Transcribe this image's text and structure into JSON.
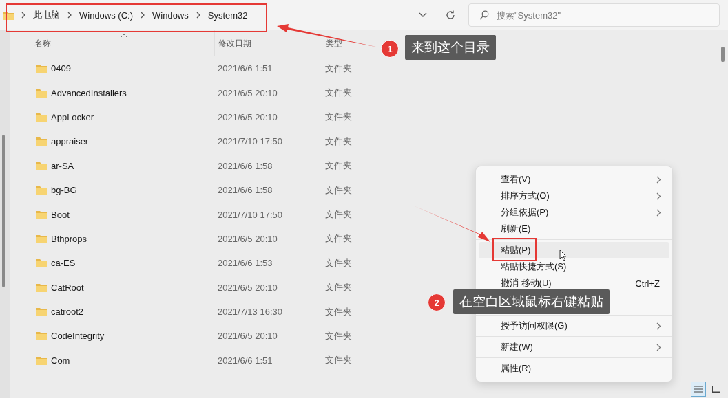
{
  "breadcrumb": [
    {
      "label": "此电脑"
    },
    {
      "label": "Windows (C:)"
    },
    {
      "label": "Windows"
    },
    {
      "label": "System32"
    }
  ],
  "search": {
    "placeholder": "搜索\"System32\""
  },
  "columns": [
    {
      "label": "名称",
      "sorted": true
    },
    {
      "label": "修改日期",
      "sorted": false
    },
    {
      "label": "类型",
      "sorted": false
    }
  ],
  "rows": [
    {
      "name": "0409",
      "date": "2021/6/6 1:51",
      "type": "文件夹"
    },
    {
      "name": "AdvancedInstallers",
      "date": "2021/6/5 20:10",
      "type": "文件夹"
    },
    {
      "name": "AppLocker",
      "date": "2021/6/5 20:10",
      "type": "文件夹"
    },
    {
      "name": "appraiser",
      "date": "2021/7/10 17:50",
      "type": "文件夹"
    },
    {
      "name": "ar-SA",
      "date": "2021/6/6 1:58",
      "type": "文件夹"
    },
    {
      "name": "bg-BG",
      "date": "2021/6/6 1:58",
      "type": "文件夹"
    },
    {
      "name": "Boot",
      "date": "2021/7/10 17:50",
      "type": "文件夹"
    },
    {
      "name": "Bthprops",
      "date": "2021/6/5 20:10",
      "type": "文件夹"
    },
    {
      "name": "ca-ES",
      "date": "2021/6/6 1:53",
      "type": "文件夹"
    },
    {
      "name": "CatRoot",
      "date": "2021/6/5 20:10",
      "type": "文件夹"
    },
    {
      "name": "catroot2",
      "date": "2021/7/13 16:30",
      "type": "文件夹"
    },
    {
      "name": "CodeIntegrity",
      "date": "2021/6/5 20:10",
      "type": "文件夹"
    },
    {
      "name": "Com",
      "date": "2021/6/6 1:51",
      "type": "文件夹"
    }
  ],
  "context_menu": {
    "groups": [
      [
        {
          "label": "查看(V)",
          "submenu": true,
          "selected": false
        },
        {
          "label": "排序方式(O)",
          "submenu": true,
          "selected": false
        },
        {
          "label": "分组依据(P)",
          "submenu": true,
          "selected": false
        },
        {
          "label": "刷新(E)",
          "submenu": false,
          "selected": false
        }
      ],
      [
        {
          "label": "粘贴(P)",
          "submenu": false,
          "selected": true
        },
        {
          "label": "粘贴快捷方式(S)",
          "submenu": false,
          "selected": false
        },
        {
          "label": "撤消 移动(U)",
          "submenu": false,
          "selected": false,
          "shortcut": "Ctrl+Z"
        }
      ],
      [
        {
          "label": "授予访问权限(G)",
          "submenu": true,
          "selected": false
        }
      ],
      [
        {
          "label": "新建(W)",
          "submenu": true,
          "selected": false
        }
      ],
      [
        {
          "label": "属性(R)",
          "submenu": false,
          "selected": false
        }
      ]
    ]
  },
  "view_buttons": [
    {
      "kind": "details",
      "selected": true
    },
    {
      "kind": "tiles",
      "selected": false
    }
  ],
  "annotations": [
    {
      "number": "1",
      "text": "来到这个目录"
    },
    {
      "number": "2",
      "text": "在空白区域鼠标右键粘贴"
    }
  ]
}
